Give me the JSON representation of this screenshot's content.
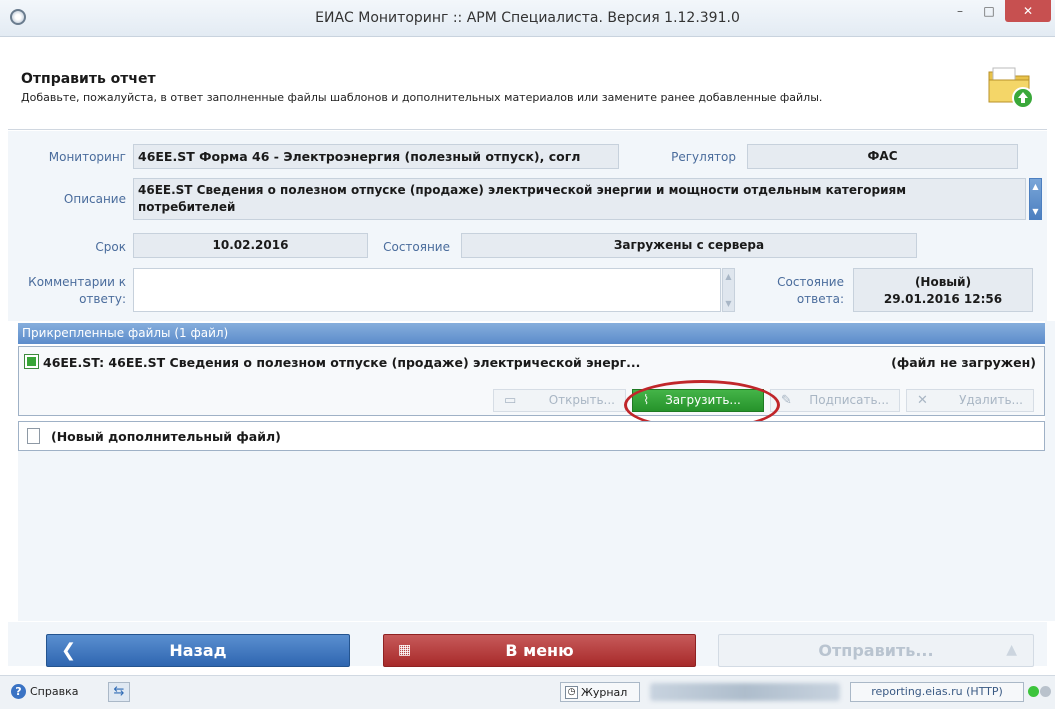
{
  "window": {
    "title": "ЕИАС Мониторинг :: АРМ Специалиста. Версия 1.12.391.0",
    "minimize": "–",
    "maximize": "□",
    "close": "✕"
  },
  "header": {
    "title": "Отправить отчет",
    "subtitle": "Добавьте, пожалуйста, в ответ заполненные файлы шаблонов и дополнительных материалов или замените ранее добавленные файлы."
  },
  "form": {
    "monitoring_label": "Мониторинг",
    "monitoring_value": "46EE.ST  Форма 46 - Электроэнергия (полезный отпуск), согл",
    "regulator_label": "Регулятор",
    "regulator_value": "ФАС",
    "description_label": "Описание",
    "description_value": "46EE.ST  Сведения о полезном отпуске (продаже) электрической энергии и мощности отдельным категориям потребителей",
    "deadline_label": "Срок",
    "deadline_value": "10.02.2016",
    "state_label": "Состояние",
    "state_value": "Загружены с сервера",
    "comment_label": "Комментарии к ответу:",
    "comment_value": "",
    "answer_state_label": "Состояние ответа:",
    "answer_state_value": "(Новый)",
    "answer_state_date": "29.01.2016 12:56"
  },
  "files": {
    "header": "Прикрепленные файлы (1 файл)",
    "items": [
      {
        "name": "46EE.ST: 46EE.ST Сведения о полезном отпуске (продаже) электрической энерг...",
        "status": "(файл не загружен)",
        "icon": "excel-file-icon"
      }
    ],
    "buttons": {
      "open": "Открыть...",
      "upload": "Загрузить...",
      "sign": "Подписать...",
      "delete": "Удалить..."
    },
    "new_file_label": "(Новый дополнительный файл)"
  },
  "nav": {
    "back": "Назад",
    "menu": "В меню",
    "send": "Отправить..."
  },
  "statusbar": {
    "help": "Справка",
    "journal": "Журнал",
    "server": "reporting.eias.ru (HTTP)"
  },
  "colors": {
    "accent_blue": "#3a73c4",
    "upload_green": "#2ea332",
    "menu_red": "#b03535",
    "highlight_ellipse": "#c0262a",
    "status_green": "#3cc43c"
  }
}
